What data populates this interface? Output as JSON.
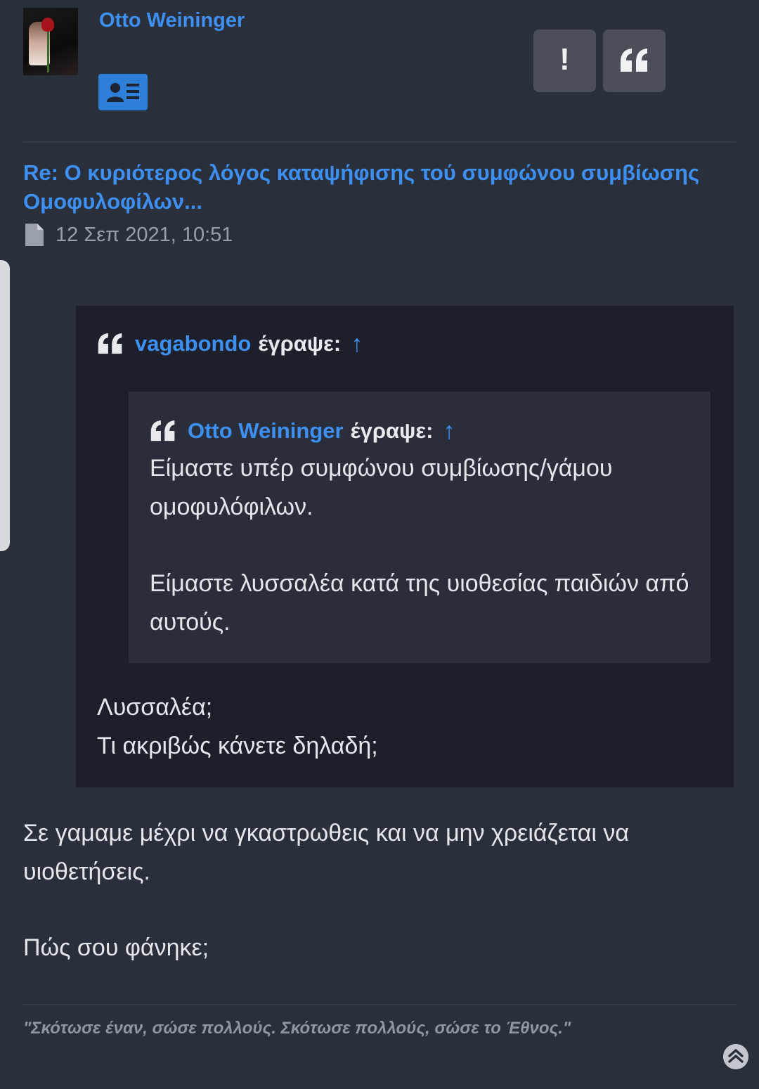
{
  "post": {
    "author": "Otto Weininger",
    "avatar_icon": "avatar-rose-image",
    "profile_icon": "contact-card-icon",
    "report_label": "!",
    "quote_icon": "quote-icon",
    "title": "Re: Ο κυριότερος λόγος καταψήφισης τού συμφώνου συμβίωσης Ομοφυλοφίλων...",
    "date_icon": "file-icon",
    "date": "12 Σεπ 2021, 10:51"
  },
  "quote_outer": {
    "author": "vagabondo",
    "wrote": "έγραψε:",
    "arrow": "↑",
    "text_line1": "Λυσσαλέα;",
    "text_line2": "Τι ακριβώς κάνετε δηλαδή;"
  },
  "quote_inner": {
    "author": "Otto Weininger",
    "wrote": "έγραψε:",
    "arrow": "↑",
    "p1": "Είμαστε υπέρ συμφώνου συμβίωσης/γάμου ομοφυλόφιλων.",
    "p2": "Είμαστε λυσσαλέα κατά της υιοθεσίας παιδιών από αυτούς."
  },
  "body": {
    "p1": "Σε γαμαμε μέχρι να γκαστρωθεις και να μην χρειάζεται να υιοθετήσεις.",
    "p2": "Πώς σου φάνηκε;"
  },
  "signature": "\"Σκότωσε έναν, σώσε πολλούς. Σκότωσε πολλούς, σώσε το Έθνος.\"",
  "colors": {
    "background": "#2a2f3c",
    "link": "#3d8ff0",
    "quote_bg": "#1d202b",
    "nested_quote_bg": "#2a2e3b"
  }
}
